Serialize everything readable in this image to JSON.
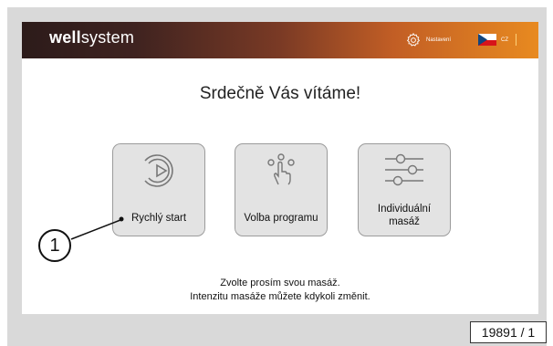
{
  "header": {
    "logo_bold": "well",
    "logo_light": "system",
    "settings_label": "Nastavení",
    "settings_icon": "gear-icon",
    "language_code": "CZ",
    "language_flag": "czech-flag-icon"
  },
  "main": {
    "welcome_title": "Srdečně Vás vítáme!",
    "buttons": [
      {
        "label": "Rychlý start",
        "icon": "quick-start-icon"
      },
      {
        "label": "Volba programu",
        "icon": "touch-select-icon"
      },
      {
        "label_line1": "Individuální",
        "label_line2": "masáž",
        "icon": "sliders-icon"
      }
    ],
    "info_line1": "Zvolte prosím svou masáž.",
    "info_line2": "Intenzitu masáže můžete kdykoli změnit."
  },
  "annotations": {
    "callout_number": "1",
    "figure_number": "19891 / 1"
  },
  "colors": {
    "header_start": "#2c1b1a",
    "header_end": "#e88a20",
    "button_bg": "#e3e3e3",
    "frame_bg": "#d9d9d9"
  }
}
